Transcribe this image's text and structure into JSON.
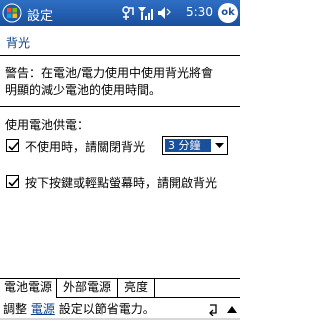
{
  "titlebar": {
    "title": "設定",
    "time": "5:30",
    "ok_label": "ok"
  },
  "page": {
    "heading": "背光",
    "warning_line1": "警告：在電池/電力使用中使用背光將會",
    "warning_line2": "明顯的減少電池的使用時間。",
    "section_label": "使用電池供電："
  },
  "options": {
    "turn_off_label": "不使用時，請關閉背光",
    "turn_off_checked": true,
    "timeout_value": "3 分鐘",
    "turn_on_label": "按下按鍵或輕點螢幕時，請開啟背光",
    "turn_on_checked": true
  },
  "tabs": [
    {
      "label": "電池電源",
      "active": true
    },
    {
      "label": "外部電源",
      "active": false
    },
    {
      "label": "亮度",
      "active": false
    }
  ],
  "footer": {
    "prefix": "調整",
    "link": "電源",
    "suffix": "設定以節省電力。"
  },
  "colors": {
    "title_bar": "#1a4f9e",
    "link": "#0a3f8a",
    "selection": "#1a4f9e"
  },
  "icons": {
    "window": "windows-flag-icon",
    "connectivity": "connectivity-icon",
    "signal": "signal-icon",
    "volume": "volume-icon",
    "keyboard": "keyboard-icon",
    "scroll": "scroll-up-icon"
  }
}
